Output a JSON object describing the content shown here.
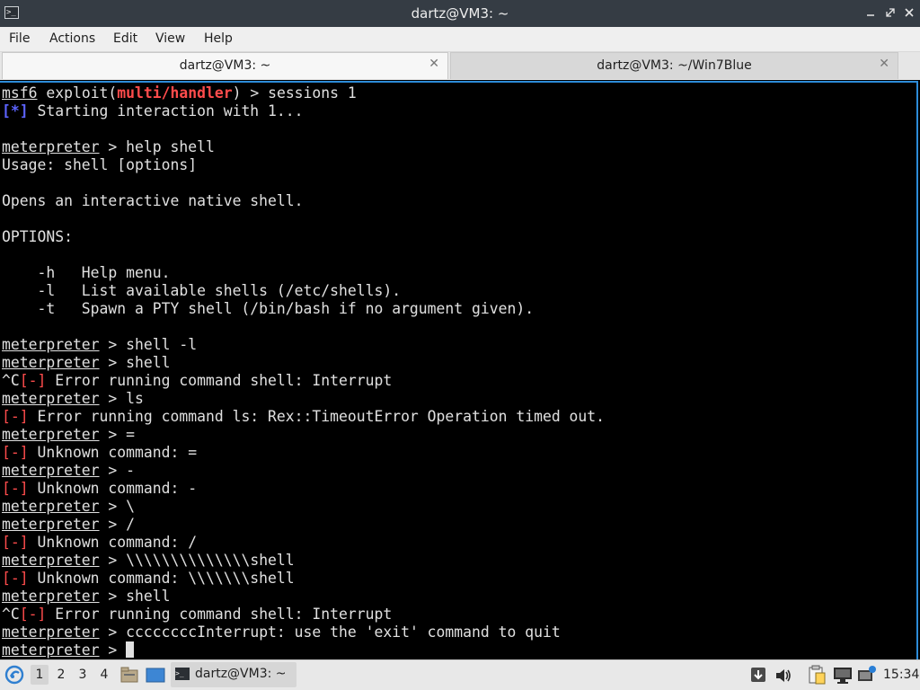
{
  "window": {
    "title": "dartz@VM3: ~",
    "app_icon_glyph": ">_"
  },
  "menu": {
    "items": [
      {
        "label": "File"
      },
      {
        "label": "Actions"
      },
      {
        "label": "Edit"
      },
      {
        "label": "View"
      },
      {
        "label": "Help"
      }
    ]
  },
  "tabs": [
    {
      "label": "dartz@VM3: ~",
      "active": true
    },
    {
      "label": "dartz@VM3: ~/Win7Blue",
      "active": false
    }
  ],
  "terminal": {
    "prompt_word": "meterpreter",
    "msf_prefix": "msf6",
    "msf_exploit_open": " exploit(",
    "msf_module": "multi/handler",
    "msf_close": ") > ",
    "prompt_suffix": " > ",
    "info_tag": "[*]",
    "error_tag": "[-]",
    "ctrl_c": "^C",
    "lines": [
      {
        "t": "msf",
        "cmd": "sessions 1"
      },
      {
        "t": "info",
        "text": " Starting interaction with 1..."
      },
      {
        "t": "blank"
      },
      {
        "t": "prompt",
        "cmd": "help shell"
      },
      {
        "t": "text",
        "text": "Usage: shell [options]"
      },
      {
        "t": "blank"
      },
      {
        "t": "text",
        "text": "Opens an interactive native shell."
      },
      {
        "t": "blank"
      },
      {
        "t": "text",
        "text": "OPTIONS:"
      },
      {
        "t": "blank"
      },
      {
        "t": "text",
        "text": "    -h   Help menu."
      },
      {
        "t": "text",
        "text": "    -l   List available shells (/etc/shells)."
      },
      {
        "t": "text",
        "text": "    -t   Spawn a PTY shell (/bin/bash if no argument given)."
      },
      {
        "t": "blank"
      },
      {
        "t": "prompt",
        "cmd": "shell -l"
      },
      {
        "t": "prompt",
        "cmd": "shell"
      },
      {
        "t": "ctrlerr",
        "text": " Error running command shell: Interrupt"
      },
      {
        "t": "prompt",
        "cmd": "ls"
      },
      {
        "t": "err",
        "text": " Error running command ls: Rex::TimeoutError Operation timed out."
      },
      {
        "t": "prompt",
        "cmd": "="
      },
      {
        "t": "err",
        "text": " Unknown command: ="
      },
      {
        "t": "prompt",
        "cmd": "-"
      },
      {
        "t": "err",
        "text": " Unknown command: -"
      },
      {
        "t": "prompt",
        "cmd": "\\"
      },
      {
        "t": "prompt",
        "cmd": "/"
      },
      {
        "t": "err",
        "text": " Unknown command: /"
      },
      {
        "t": "prompt",
        "cmd": "\\\\\\\\\\\\\\\\\\\\\\\\\\\\shell"
      },
      {
        "t": "err",
        "text": " Unknown command: \\\\\\\\\\\\\\shell"
      },
      {
        "t": "prompt",
        "cmd": "shell"
      },
      {
        "t": "ctrlerr",
        "text": " Error running command shell: Interrupt"
      },
      {
        "t": "prompt",
        "cmd": "ccccccccInterrupt: use the 'exit' command to quit"
      },
      {
        "t": "prompt",
        "cmd": "",
        "cursor": true
      }
    ]
  },
  "taskbar": {
    "workspaces": [
      "1",
      "2",
      "3",
      "4"
    ],
    "active_workspace": "1",
    "task_label": "dartz@VM3: ~",
    "clock": "15:34",
    "icons": [
      "start-menu-icon",
      "file-manager-icon",
      "desktop-icon",
      "terminal-icon",
      "download-icon",
      "volume-icon",
      "clipboard-icon",
      "monitor-icon",
      "network-icon"
    ]
  },
  "colors": {
    "accent": "#2d8cd9",
    "error_red": "#ff4c4c",
    "info_blue": "#5c63ff",
    "titlebar": "#353c44"
  }
}
